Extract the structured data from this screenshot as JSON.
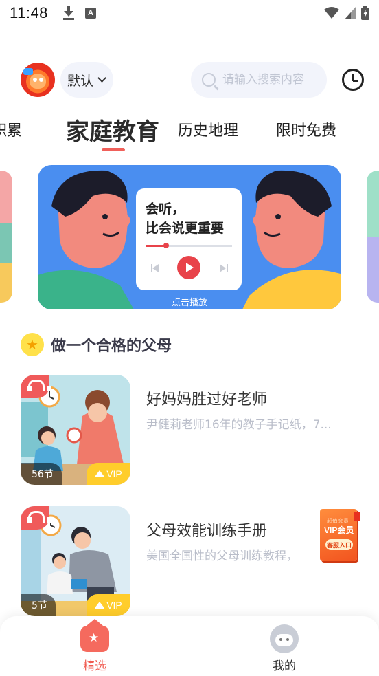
{
  "status_bar": {
    "time": "11:48"
  },
  "header": {
    "mode_label": "默认",
    "search_placeholder": "请输入搜索内容"
  },
  "tabs": [
    {
      "label": "积累"
    },
    {
      "label": "家庭教育",
      "active": true
    },
    {
      "label": "历史地理"
    },
    {
      "label": "限时免费"
    }
  ],
  "banner": {
    "card_title_line1": "会听，",
    "card_title_line2": "比会说更重要",
    "progress": 0.24,
    "caption": "点击播放"
  },
  "section": {
    "title": "做一个合格的父母"
  },
  "courses": [
    {
      "title": "好妈妈胜过好老师",
      "description": "尹健莉老师16年的教子手记纸，7...",
      "lessons": "56节",
      "vip": "VIP"
    },
    {
      "title": "父母效能训练手册",
      "description": "美国全国性的父母训练教程，",
      "lessons": "5节",
      "vip": "VIP"
    }
  ],
  "vip_entry": {
    "top_text": "超值会员",
    "main_text": "VIP会员",
    "button_text": "客服入口"
  },
  "tabbar": {
    "home_label": "精选",
    "me_label": "我的",
    "active_color": "#f05a4f",
    "inactive_color": "#333333"
  },
  "colors": {
    "accent": "#f0605a",
    "banner_bg": "#4a8ef0",
    "vip_yellow": "#ffcd2b"
  }
}
